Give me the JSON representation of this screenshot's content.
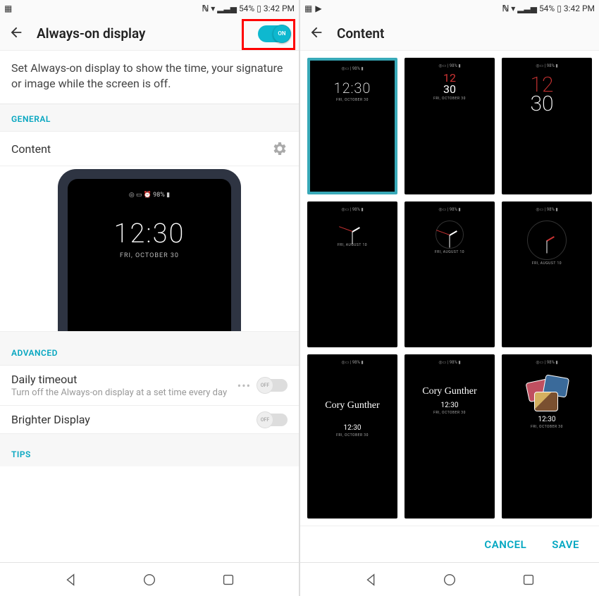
{
  "status": {
    "battery": "54%",
    "time": "3:42 PM"
  },
  "left": {
    "title": "Always-on display",
    "toggle": "ON",
    "desc": "Set Always-on display to show the time, your signature or image while the screen is off.",
    "general": "GENERAL",
    "content": "Content",
    "preview": {
      "stat": "◎ ▭ ⏰  98% ▮",
      "time": "12:30",
      "date": "FRI, OCTOBER 30"
    },
    "advanced": "ADVANCED",
    "daily": {
      "t": "Daily timeout",
      "s": "Turn off the Always-on display at a set time every day",
      "state": "OFF"
    },
    "brighter": {
      "t": "Brighter Display",
      "state": "OFF"
    },
    "tips": "TIPS"
  },
  "right": {
    "title": "Content",
    "cancel": "CANCEL",
    "save": "SAVE",
    "tstat": "◎▭ | 98% ▮",
    "thumbs": [
      {
        "time": "12:30",
        "date": "FRI, OCTOBER 30",
        "selected": true,
        "style": "digital-plain"
      },
      {
        "time_top": "12",
        "time_bot": "30",
        "date": "FRI, OCTOBER 30",
        "style": "digital-stack-red"
      },
      {
        "time_top": "12",
        "time_bot": "30",
        "style": "digital-big-red"
      },
      {
        "date": "FRI, AUGUST 10",
        "style": "analog-small"
      },
      {
        "date": "FRI, AUGUST 10",
        "style": "analog-mid"
      },
      {
        "date": "FRI, AUGUST 10",
        "style": "analog-big"
      },
      {
        "sig": "Cory Gunther",
        "time": "12:30",
        "date": "FRI, OCTOBER 30",
        "style": "sig-low"
      },
      {
        "sig": "Cory Gunther",
        "time": "12:30",
        "date": "FRI, OCTOBER 30",
        "style": "sig-high"
      },
      {
        "time": "12:30",
        "date": "FRI, OCTOBER 30",
        "style": "photos"
      }
    ]
  }
}
